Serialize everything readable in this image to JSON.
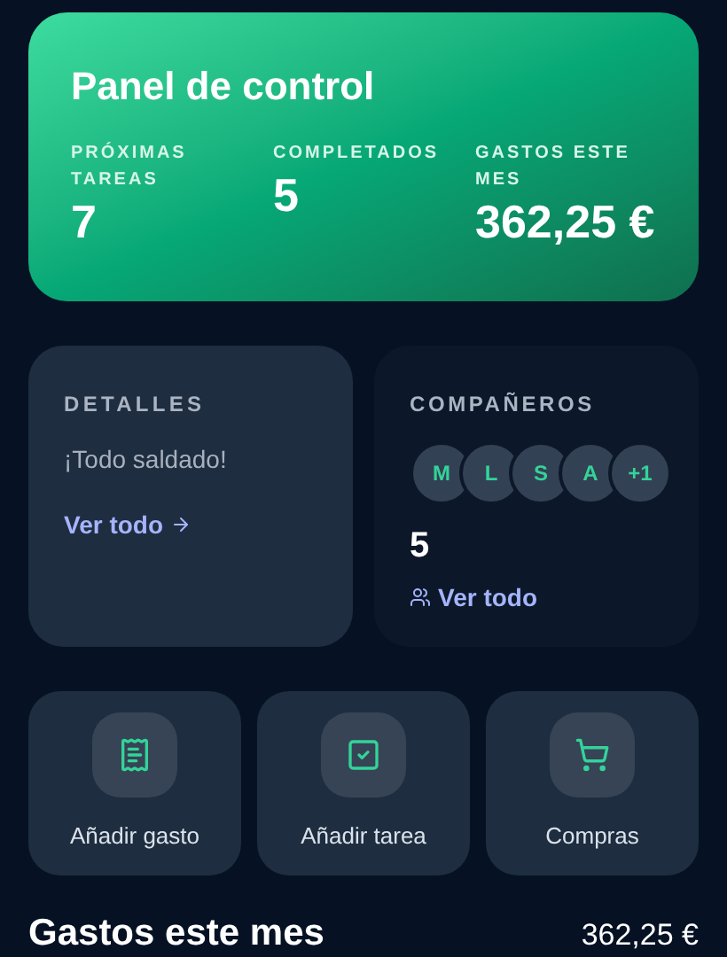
{
  "header": {
    "title": "Panel de control",
    "stats": [
      {
        "label": "PRÓXIMAS TAREAS",
        "value": "7"
      },
      {
        "label": "COMPLETADOS",
        "value": "5"
      },
      {
        "label": "GASTOS ESTE MES",
        "value": "362,25 €"
      }
    ]
  },
  "details": {
    "title": "DETALLES",
    "message": "¡Todo saldado!",
    "link": "Ver todo"
  },
  "companions": {
    "title": "COMPAÑEROS",
    "avatars": [
      "M",
      "L",
      "S",
      "A",
      "+1"
    ],
    "count": "5",
    "link": "Ver todo"
  },
  "actions": [
    {
      "kind": "expense",
      "label": "Añadir gasto"
    },
    {
      "kind": "task",
      "label": "Añadir tarea"
    },
    {
      "kind": "shopping",
      "label": "Compras"
    }
  ],
  "expenses": {
    "title": "Gastos este mes",
    "total": "362,25 €"
  }
}
